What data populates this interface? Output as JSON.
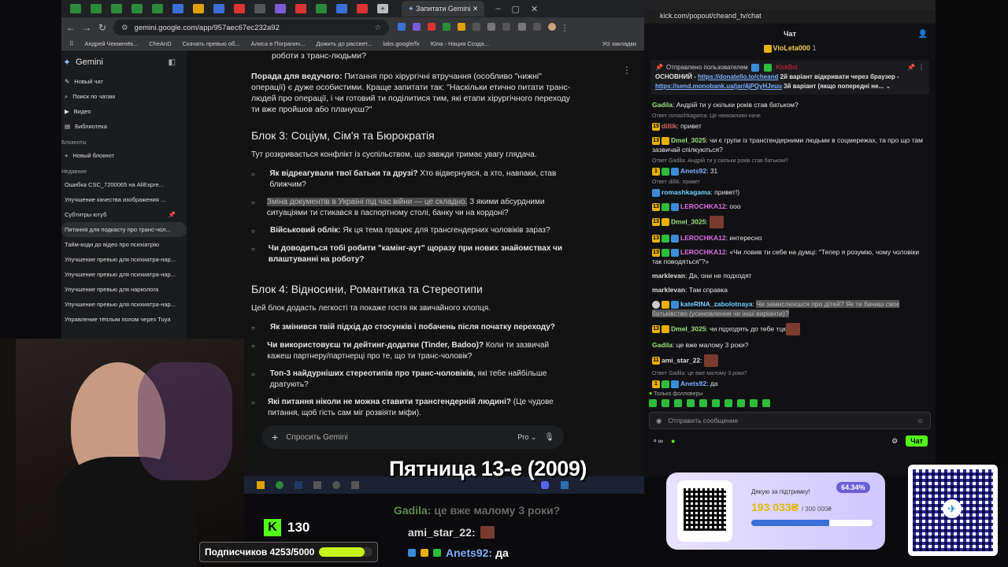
{
  "browser": {
    "tab_title": "Запитати Gemini",
    "url": "gemini.google.com/app/957aec67ec232a92",
    "bookmarks": [
      "Андрей Чекменёк...",
      "CheAnD",
      "Скачать превью об...",
      "Алиса в Погранич...",
      "Дожить до рассвет...",
      "labs.google/fx",
      "Юла - Нация Созда..."
    ],
    "bookmarks_all": "Усі закладки"
  },
  "gemini": {
    "brand": "Gemini",
    "new_chat": "Новый чат",
    "search_chats": "Поиск по чатам",
    "video": "Видео",
    "library": "Библиотека",
    "notebooks_header": "Блокноты",
    "new_notebook": "Новый блокнот",
    "recent_header": "Недавние",
    "recent": [
      "Ошибка CSC_7200065 на AliExpre...",
      "Улучшение качества изображения ...",
      "Субтитры ютуб",
      "Питання для подкасту про транс-чол...",
      "Тайм-коди до відео про психіатрію",
      "Улучшение превью для психиатра-нар...",
      "Улучшение превью для психиатра-нар...",
      "Улучшение превью для нарколога",
      "Улучшение превью для психиатра-нар...",
      "Управление тёплым полом через Tuya"
    ],
    "top_fragment": "роботи з транс-людьми?",
    "tip_label": "Порада для ведучого:",
    "tip_text": " Питання про хірургічні втручання (особливо \"нижні\" операції) є дуже особистими. Краще запитати так: \"Наскільки етично питати транс-людей про операції, і чи готовий ти поділитися тим, які етапи хірургічного переходу ти вже пройшов або плануєш?\"",
    "block3_title": "Блок 3: Соціум, Сім'я та Бюрократія",
    "block3_intro": "Тут розкривається конфлікт із суспільством, що завжди тримає увагу глядача.",
    "block3_items": [
      {
        "bold": "Як відреагували твої батьки та друзі?",
        "rest": " Хто відвернувся, а хто, навпаки, став ближчим?"
      },
      {
        "hl": "Зміна документів в Україні під час війни — це складно.",
        "rest": " З якими абсурдними ситуаціями ти стикався в паспортному столі, банку чи на кордоні?"
      },
      {
        "bold": "Військовий облік:",
        "rest": " Як ця тема працює для трансгендерних чоловіків зараз?"
      },
      {
        "bold": "Чи доводиться тобі робити \"камінг-аут\" щоразу при нових знайомствах чи влаштуванні на роботу?",
        "rest": ""
      }
    ],
    "block4_title": "Блок 4: Відносини, Романтика та Стереотипи",
    "block4_intro": "Цей блок додасть легкості та покаже гостя як звичайного хлопця.",
    "block4_items": [
      {
        "bold": "Як змінився твій підхід до стосунків і побачень після початку переходу?",
        "rest": ""
      },
      {
        "bold": "Чи використовуєш ти дейтинг-додатки (Tinder, Badoo)?",
        "rest": " Коли ти зазвичай кажеш партнеру/партнерці про те, що ти транс-чоловік?"
      },
      {
        "bold": "Топ-3 найдурніших стереотипів про транс-чоловіків,",
        "rest": " які тебе найбільше дратують?"
      },
      {
        "bold": "Які питання ніколи не можна ставити трансгендерній людині?",
        "rest": " (Це чудове питання, щоб гість сам міг розвіяти міфи)."
      }
    ],
    "prompt_placeholder": "Спросить Gemini",
    "model": "Pro"
  },
  "chat": {
    "url": "kick.com/popout/cheand_tv/chat",
    "title": "Чат",
    "top_user": "VioLeta000",
    "top_count": "1",
    "pinned_by": "Отправлено пользователем",
    "pinned_user": "KickBot",
    "pinned_line1a": "ОСНОВНИЙ - ",
    "pinned_link1": "https://donatello.to/cheand",
    "pinned_line1b": " 2й варіант відкривати через браузер -",
    "pinned_link2": "https://send.monobank.ua/jar/4jPQyHJeuu",
    "pinned_line2b": " 3й варіант (якщо попередні не...",
    "messages": [
      {
        "reply": "",
        "user": "Gadila",
        "color": "#9be27a",
        "badges": "",
        "text": "Андрій ти у скільки років став батьком?"
      },
      {
        "reply": "Ответ romashkagama: Це неможливо наче",
        "user": "dillik",
        "color": "#d66",
        "badges": "15",
        "text": "привет"
      },
      {
        "reply": "",
        "user": "Dmel_3025",
        "color": "#9be27a",
        "badges": "13",
        "text": "чи є групи із трансгендерними людьми в соцмережах, та про що там зазвичай спілкуються?"
      },
      {
        "reply": "Ответ Gadila: Андрій ти у скільки років став батьком?",
        "user": "Anets92",
        "color": "#7ab0ff",
        "badges": "1",
        "text": "31"
      },
      {
        "reply": "Ответ dillik: привет",
        "user": "romashkagama",
        "color": "#6fd0ff",
        "badges": "",
        "text": "привет!)"
      },
      {
        "reply": "",
        "user": "LEROCHKA12",
        "color": "#e06de6",
        "badges": "13",
        "text": "ооо"
      },
      {
        "reply": "",
        "user": "Dmel_3025",
        "color": "#9be27a",
        "badges": "13",
        "text": ""
      },
      {
        "reply": "",
        "user": "LEROCHKA12",
        "color": "#e06de6",
        "badges": "13",
        "text": "интересно"
      },
      {
        "reply": "",
        "user": "LEROCHKA12",
        "color": "#e06de6",
        "badges": "13",
        "text": "«Чи ловив ти себе на думці: \"Тепер я розумію, чому чоловіки так поводяться\"?»"
      },
      {
        "reply": "",
        "user": "marklevan",
        "color": "#ddd",
        "badges": "",
        "text": "Да, они не подходят"
      },
      {
        "reply": "",
        "user": "marklevan",
        "color": "#ddd",
        "badges": "",
        "text": "Там справка"
      },
      {
        "reply": "",
        "user": "kateRINA_zabolotnaya",
        "color": "#6fd0ff",
        "badges": "",
        "text": "Чи замислюєшся про дітей? Як ти бачиш своє батьківство (усиновлення чи інші варіанти)?"
      },
      {
        "reply": "",
        "user": "Dmel_3025",
        "color": "#9be27a",
        "badges": "13",
        "text": "чи підходять до тебе тцк"
      },
      {
        "reply": "",
        "user": "Gadila",
        "color": "#9be27a",
        "badges": "",
        "text": "це вже малому 3 роки?"
      },
      {
        "reply": "",
        "user": "ami_star_22",
        "color": "#ddd",
        "badges": "11",
        "text": ""
      },
      {
        "reply": "Ответ Gadila: це вже малому 3 роки?",
        "user": "Anets92",
        "color": "#7ab0ff",
        "badges": "1",
        "text": "да"
      }
    ],
    "followers_only": "Только фолловеры",
    "input_placeholder": "Отправить сообщение",
    "send_label": "Чат"
  },
  "overlay": {
    "title_banner": "Пятница 13-е (2009)",
    "kick_count": "130",
    "subs_label": "Подписчиков 4253/5000",
    "subs_progress": 0.85,
    "ov_msg1_user": "Gadila",
    "ov_msg1_text": "це вже малому 3 роки?",
    "ov_msg2_user": "ami_star_22:",
    "ov_msg3_user": "Anets92:",
    "ov_msg3_text": "да",
    "donate_thanks": "Дякую за підтримку!",
    "donate_percent": "64.34%",
    "donate_amount": "193 033₴",
    "donate_goal": "/ 300 000₴",
    "donate_progress": 0.6434
  }
}
